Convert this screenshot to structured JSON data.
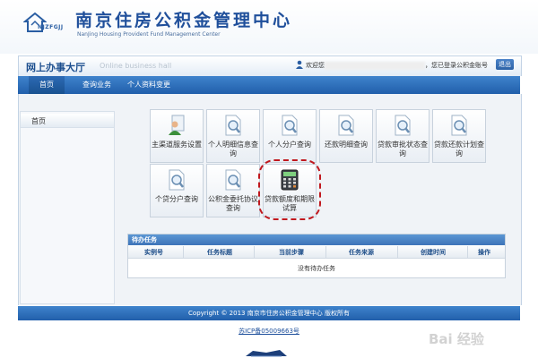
{
  "header": {
    "logo_abbr": "NJZFGJJ",
    "title_cn": "南京住房公积金管理中心",
    "title_en": "NanJing Housing Provident Fund Management Center"
  },
  "topbar": {
    "hall_title": "网上办事大厅",
    "hall_sub": "Online business hall",
    "welcome_prefix": "欢迎您",
    "welcome_suffix": "，您已登录公积金账号",
    "logout_label": "退出"
  },
  "nav": {
    "items": [
      {
        "label": "首页",
        "active": true
      },
      {
        "label": "查询业务",
        "active": false
      },
      {
        "label": "个人资料变更",
        "active": false
      }
    ]
  },
  "sidebar": {
    "items": [
      {
        "label": "首页"
      }
    ]
  },
  "tiles": [
    {
      "label": "主渠道服务设置",
      "icon": "user-settings-icon"
    },
    {
      "label": "个人明细信息查询",
      "icon": "document-search-icon"
    },
    {
      "label": "个人分户查询",
      "icon": "document-search-icon"
    },
    {
      "label": "还款明细查询",
      "icon": "document-search-icon"
    },
    {
      "label": "贷款审批状态查询",
      "icon": "document-search-icon"
    },
    {
      "label": "贷款还款计划查询",
      "icon": "document-search-icon"
    },
    {
      "label": "个贷分户查询",
      "icon": "document-search-icon"
    },
    {
      "label": "公积金委托协议查询",
      "icon": "document-search-icon"
    },
    {
      "label": "贷款额度和期限试算",
      "icon": "calculator-icon"
    }
  ],
  "tasks": {
    "title": "待办任务",
    "columns": [
      "实例号",
      "任务标题",
      "当前步骤",
      "任务来源",
      "创建时间",
      "操作"
    ],
    "empty_text": "没有待办任务"
  },
  "footer": {
    "copyright": "Copyright © 2013 南京市住房公积金管理中心 版权所有",
    "icp": "苏ICP备05009663号"
  },
  "watermark": {
    "text": "Bai  经验"
  },
  "colors": {
    "primary_blue": "#2a68b3",
    "highlight_red": "#c0181e"
  }
}
